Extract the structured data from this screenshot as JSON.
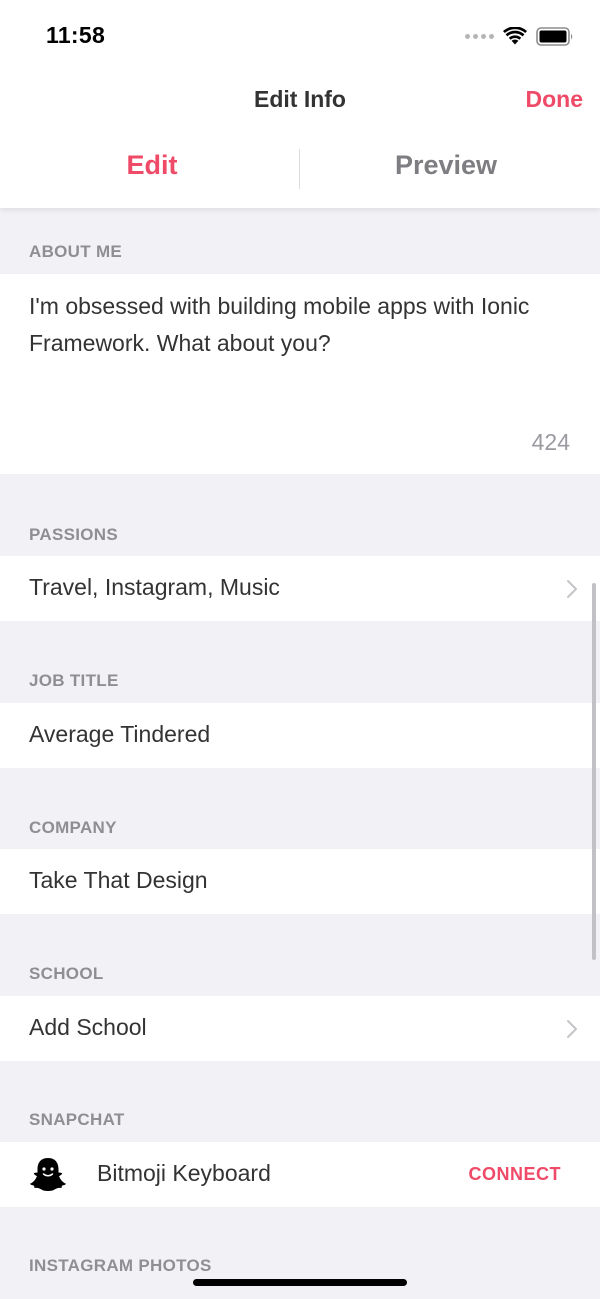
{
  "status": {
    "time": "11:58"
  },
  "nav": {
    "title": "Edit Info",
    "done": "Done"
  },
  "segment": {
    "edit": "Edit",
    "preview": "Preview"
  },
  "about": {
    "header": "ABOUT ME",
    "text": "I'm obsessed with building mobile apps with Ionic Framework. What about you?",
    "count": "424"
  },
  "passions": {
    "header": "PASSIONS",
    "value": "Travel, Instagram, Music"
  },
  "job": {
    "header": "JOB TITLE",
    "value": "Average Tindered"
  },
  "company": {
    "header": "COMPANY",
    "value": "Take That Design"
  },
  "school": {
    "header": "SCHOOL",
    "value": "Add School"
  },
  "snapchat": {
    "header": "SNAPCHAT",
    "label": "Bitmoji Keyboard",
    "action": "CONNECT"
  },
  "instagram": {
    "header": "INSTAGRAM PHOTOS"
  },
  "colors": {
    "accent": "#ef4a67",
    "background": "#f2f2f6",
    "muted": "#8e8e93"
  },
  "icons": [
    "wifi-icon",
    "battery-icon",
    "chevron-right-icon",
    "snapchat-ghost-icon"
  ]
}
